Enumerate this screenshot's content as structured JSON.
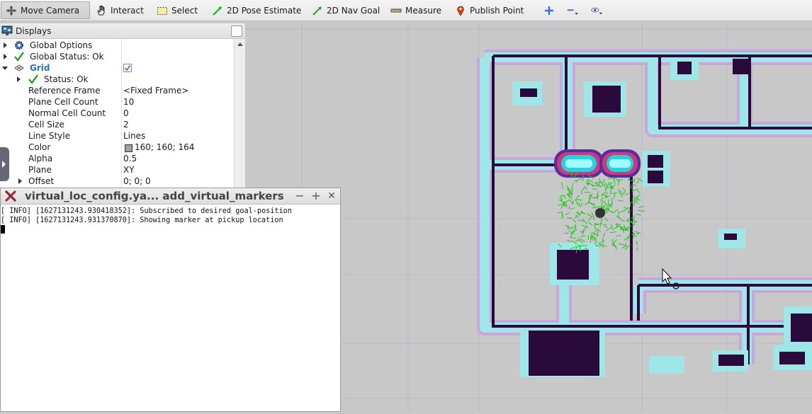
{
  "toolbar": {
    "tools": [
      {
        "label": "Move Camera",
        "icon": "move-camera-icon"
      },
      {
        "label": "Interact",
        "icon": "hand-icon"
      },
      {
        "label": "Select",
        "icon": "select-icon"
      },
      {
        "label": "2D Pose Estimate",
        "icon": "green-arrow-icon"
      },
      {
        "label": "2D Nav Goal",
        "icon": "green-arrow-icon"
      },
      {
        "label": "Measure",
        "icon": "ruler-icon"
      },
      {
        "label": "Publish Point",
        "icon": "map-pin-icon"
      }
    ],
    "extra_icons": [
      "plus-icon",
      "minus-icon",
      "eye-icon"
    ],
    "accent": "#3a6fd1"
  },
  "displays": {
    "title": "Displays",
    "rows": [
      {
        "key": "Global Options",
        "value": ""
      },
      {
        "key": "Global Status: Ok",
        "value": ""
      },
      {
        "key": "Grid",
        "value": ""
      },
      {
        "key": "Status: Ok",
        "value": ""
      },
      {
        "key": "Reference Frame",
        "value": "<Fixed Frame>"
      },
      {
        "key": "Plane Cell Count",
        "value": "10"
      },
      {
        "key": "Normal Cell Count",
        "value": "0"
      },
      {
        "key": "Cell Size",
        "value": "2"
      },
      {
        "key": "Line Style",
        "value": "Lines"
      },
      {
        "key": "Color",
        "value": "160; 160; 164"
      },
      {
        "key": "Alpha",
        "value": "0.5"
      },
      {
        "key": "Plane",
        "value": "XY"
      },
      {
        "key": "Offset",
        "value": "0; 0; 0"
      }
    ],
    "grid_checked": true,
    "grid_color_swatch": "#a0a0a4"
  },
  "terminal": {
    "title": "virtual_loc_config.ya... add_virtual_markers",
    "lines": [
      "[ INFO] [1627131243.930418352]: Subscribed to desired goal-position",
      "[ INFO] [1627131243.931370870]: Showing marker at pickup location"
    ],
    "controls": [
      "−",
      "+",
      "✕"
    ]
  },
  "map": {
    "background": "#c8c8c8",
    "wall_color": "#2a0a3a",
    "inflation_color": "#9ee7ea",
    "costmap_outer": "#c59bd8",
    "particle_color": "#1fc91f"
  }
}
